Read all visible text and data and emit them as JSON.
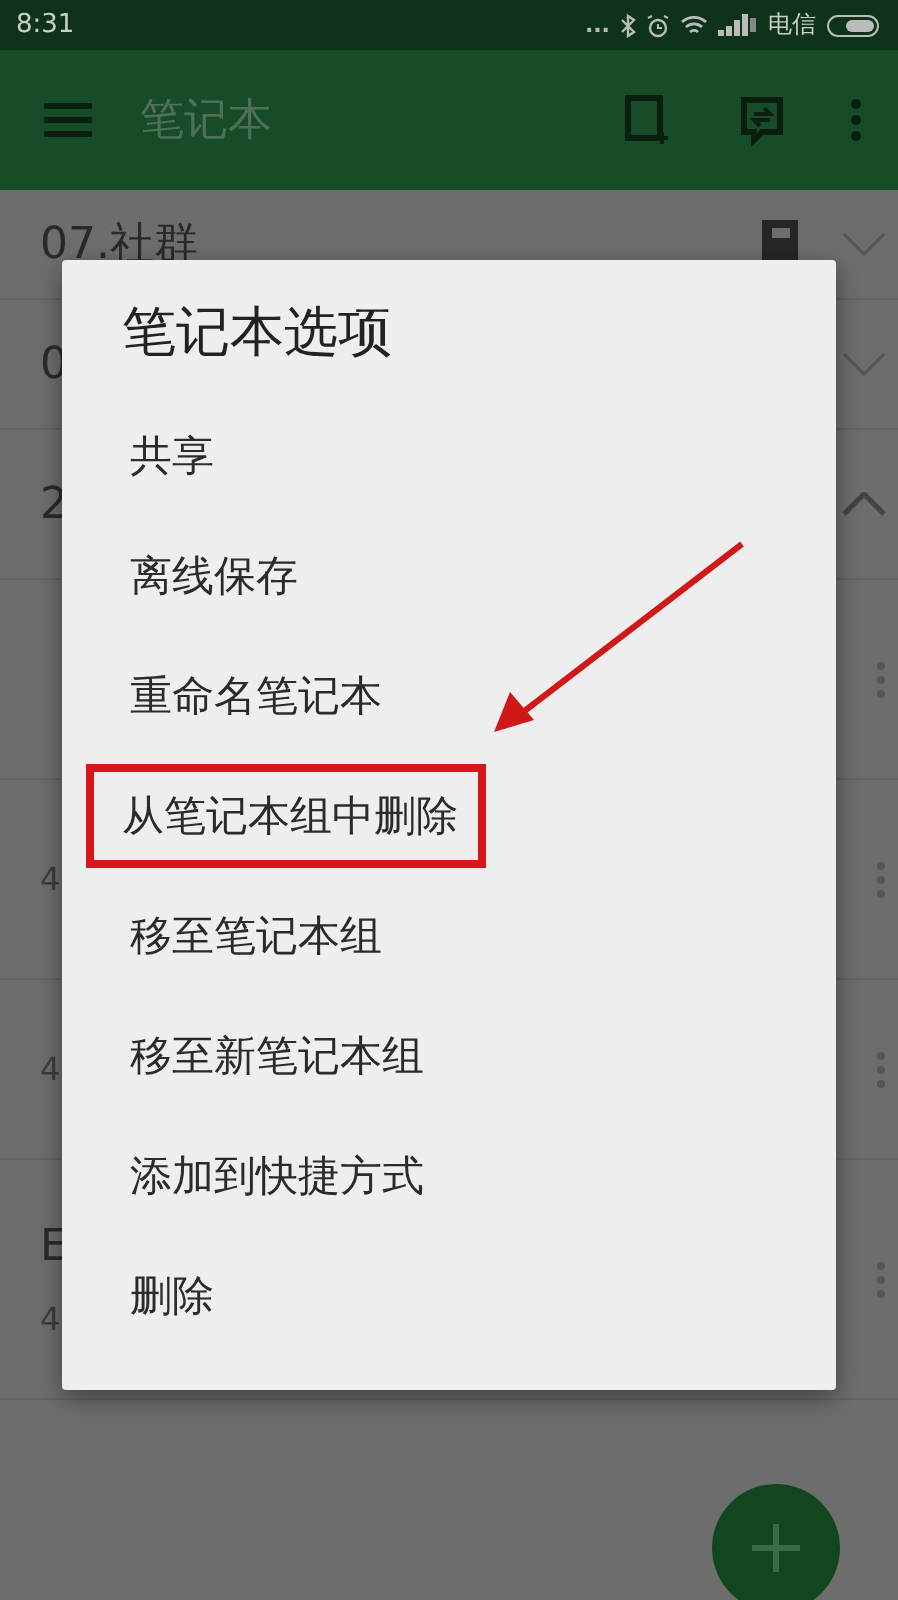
{
  "status_bar": {
    "time": "8:31",
    "carrier": "电信",
    "dots": "..."
  },
  "app_bar": {
    "title": "笔记本"
  },
  "list": [
    {
      "kind": "group",
      "title": "07.社群",
      "expanded": false
    },
    {
      "kind": "group",
      "title": "0",
      "expanded": false
    },
    {
      "kind": "group",
      "title": "2",
      "expanded": true
    },
    {
      "kind": "notebook"
    },
    {
      "kind": "notebook",
      "subtitle": "4"
    },
    {
      "kind": "notebook",
      "subtitle": "4"
    },
    {
      "kind": "notebook",
      "title": "E",
      "subtitle": "4"
    }
  ],
  "dialog": {
    "title": "笔记本选项",
    "items": [
      {
        "label": "共享",
        "highlighted": false
      },
      {
        "label": "离线保存",
        "highlighted": false
      },
      {
        "label": "重命名笔记本",
        "highlighted": false
      },
      {
        "label": "从笔记本组中删除",
        "highlighted": true
      },
      {
        "label": "移至笔记本组",
        "highlighted": false
      },
      {
        "label": "移至新笔记本组",
        "highlighted": false
      },
      {
        "label": "添加到快捷方式",
        "highlighted": false
      },
      {
        "label": "删除",
        "highlighted": false
      }
    ]
  }
}
